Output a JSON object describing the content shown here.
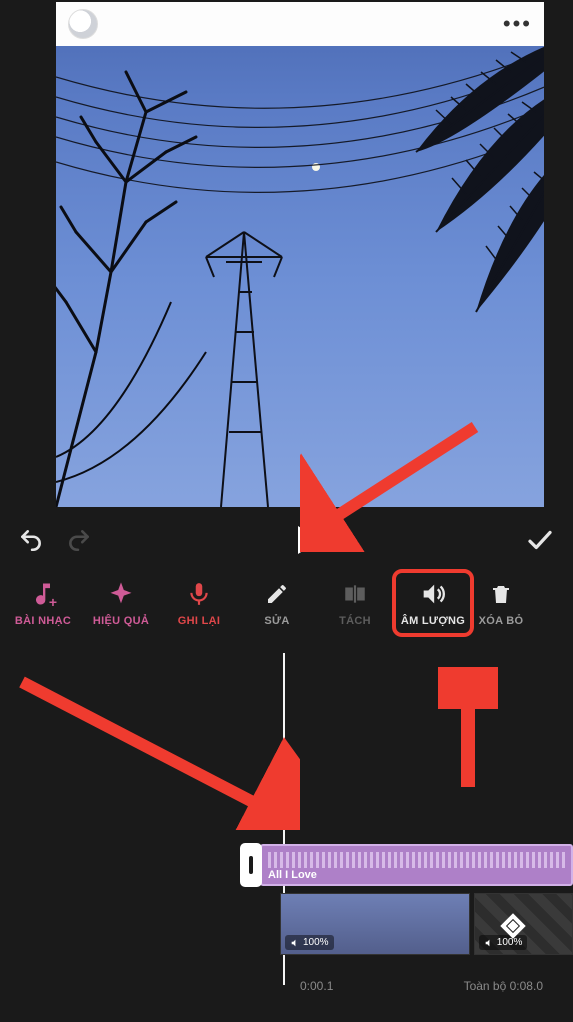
{
  "toolbar": {
    "music": "BÀI NHẠC",
    "effect": "HIỆU QUẢ",
    "record": "GHI LẠI",
    "edit": "SỬA",
    "split": "TÁCH",
    "volume": "ÂM LƯỢNG",
    "delete": "XÓA BỎ"
  },
  "audio": {
    "title": "All I Love"
  },
  "clips": {
    "video1_volume": "100%",
    "video2_volume": "100%"
  },
  "timeline": {
    "current": "0:00.1",
    "total_label": "Toàn bộ",
    "total_time": "0:08.0"
  },
  "post": {
    "more": "•••"
  },
  "annotations": {
    "highlight_target": "volume-button",
    "arrow_count": 3
  }
}
